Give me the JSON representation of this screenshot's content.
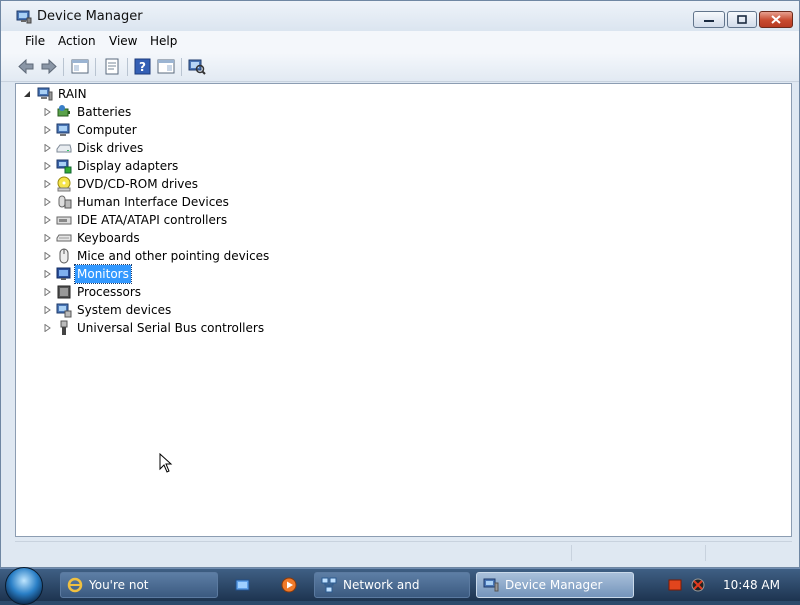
{
  "window": {
    "title": "Device Manager",
    "controls": [
      "minimize",
      "maximize",
      "close"
    ]
  },
  "menu": [
    "File",
    "Action",
    "View",
    "Help"
  ],
  "toolbar": {
    "buttons": [
      "back-icon",
      "forward-icon",
      "show-hide-console-tree-icon",
      "properties-icon",
      "help-icon",
      "action-pane-icon",
      "scan-hardware-icon"
    ]
  },
  "tree": {
    "root": "RAIN",
    "items": [
      {
        "label": "Batteries",
        "icon": "battery-icon"
      },
      {
        "label": "Computer",
        "icon": "computer-icon"
      },
      {
        "label": "Disk drives",
        "icon": "disk-drive-icon"
      },
      {
        "label": "Display adapters",
        "icon": "display-adapter-icon"
      },
      {
        "label": "DVD/CD-ROM drives",
        "icon": "dvd-drive-icon"
      },
      {
        "label": "Human Interface Devices",
        "icon": "hid-icon"
      },
      {
        "label": "IDE ATA/ATAPI controllers",
        "icon": "ide-controller-icon"
      },
      {
        "label": "Keyboards",
        "icon": "keyboard-icon"
      },
      {
        "label": "Mice and other pointing devices",
        "icon": "mouse-icon"
      },
      {
        "label": "Monitors",
        "icon": "monitor-icon",
        "selected": true
      },
      {
        "label": "Processors",
        "icon": "processor-icon"
      },
      {
        "label": "System devices",
        "icon": "system-device-icon"
      },
      {
        "label": "Universal Serial Bus controllers",
        "icon": "usb-icon"
      }
    ]
  },
  "taskbar": {
    "tasks": [
      {
        "label": "You're not connecte...",
        "icon": "internet-explorer-icon"
      },
      {
        "label": "Network and Sharing...",
        "icon": "network-icon"
      },
      {
        "label": "Device Manager",
        "icon": "device-manager-icon",
        "active": true
      }
    ],
    "quick_launch": [
      "show-desktop-icon",
      "media-player-icon"
    ],
    "clock": "10:48 AM"
  },
  "colors": {
    "selection": "#3399ff",
    "taskbar": "#2c4a6b"
  }
}
